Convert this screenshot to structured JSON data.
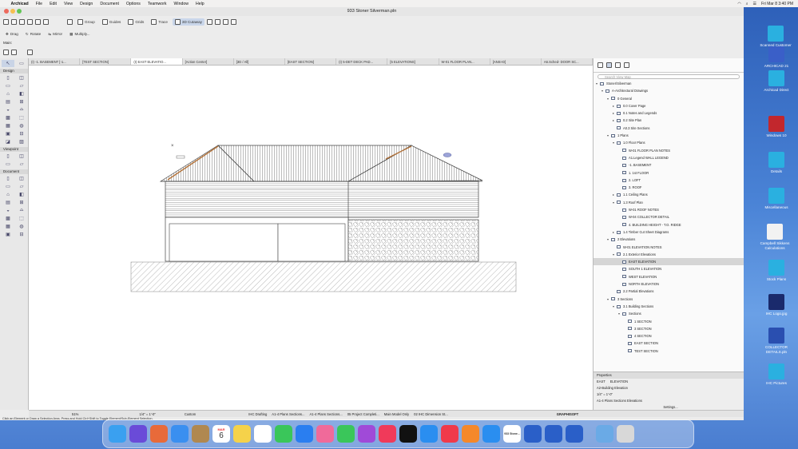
{
  "menubar": {
    "apple": "",
    "app": "Archicad",
    "items": [
      "File",
      "Edit",
      "View",
      "Design",
      "Document",
      "Options",
      "Teamwork",
      "Window",
      "Help"
    ],
    "clock": "Fri Mar 8  3:40 PM"
  },
  "window": {
    "title": "933 Stoner Silverman.pln"
  },
  "toolbar": {
    "group": "Group",
    "guides": "Guides",
    "grids": "Grids",
    "trace": "Trace",
    "cutaway": "3D Cutaway"
  },
  "toolbar2": {
    "drag": "Drag",
    "rotate": "Rotate",
    "mirror": "Mirror",
    "multiply": "Multiply...",
    "main": "Main:"
  },
  "tabs": [
    "(I) -1. BASEMENT [-1...",
    "[TEST SECTION]",
    "(I) EAST ELEVATIO...",
    "[Action Center]",
    "[3D / All]",
    "[EAST SECTION]",
    "(I) 5-DET DECK PAD...",
    "[5 ELEVATIONS]",
    "W-01 FLOOR PLAN...",
    "[ANSI-D]",
    "A6.Sched- DOOR SC..."
  ],
  "toolbox": {
    "design": "Design",
    "viewpoint": "Viewpoint",
    "document": "Document"
  },
  "navigator": {
    "search_placeholder": "Search View Map",
    "props_header": "Properties",
    "props_name_a": "EAST",
    "props_name_b": "ELEVATION",
    "props_id": "A2-Building Elevation",
    "props_scale": "1/4\"    =    1'-0\"",
    "props_layer": "A1-4 Plans Sections Elevations",
    "settings": "Settings..."
  },
  "tree": [
    {
      "d": 0,
      "t": "Stoner/Silverman",
      "a": "v"
    },
    {
      "d": 1,
      "t": "A-Architectural Drawings",
      "a": "v"
    },
    {
      "d": 2,
      "t": "0 General",
      "a": "v"
    },
    {
      "d": 3,
      "t": "0.0 Cover Page",
      "a": ">"
    },
    {
      "d": 3,
      "t": "0.1 Notes and Legends",
      "a": ">"
    },
    {
      "d": 3,
      "t": "0.2 Site Plan",
      "a": ">"
    },
    {
      "d": 3,
      "t": "A0.3 Site Sections",
      "a": ""
    },
    {
      "d": 2,
      "t": "1 Plans",
      "a": "v"
    },
    {
      "d": 3,
      "t": "1.0 Floor Plans",
      "a": "v"
    },
    {
      "d": 4,
      "t": "W-01 FLOOR PLAN NOTES",
      "a": ""
    },
    {
      "d": 4,
      "t": "A1.Legend WALL LEGEND",
      "a": ""
    },
    {
      "d": 4,
      "t": "-1. BASEMENT",
      "a": ""
    },
    {
      "d": 4,
      "t": "1. 1st FLOOR",
      "a": ""
    },
    {
      "d": 4,
      "t": "2. LOFT",
      "a": ""
    },
    {
      "d": 4,
      "t": "3. ROOF",
      "a": ""
    },
    {
      "d": 3,
      "t": "1.1 Ceiling Plans",
      "a": ">"
    },
    {
      "d": 3,
      "t": "1.3 Roof Plan",
      "a": "v"
    },
    {
      "d": 4,
      "t": "W-01 ROOF NOTES",
      "a": ""
    },
    {
      "d": 4,
      "t": "W-04 COLLECTOR DETAIL",
      "a": ""
    },
    {
      "d": 4,
      "t": "4. BUILDING HEIGHT - T.O. RIDGE",
      "a": ""
    },
    {
      "d": 3,
      "t": "1.4 Timber Cut Sheet Diagrams",
      "a": ">"
    },
    {
      "d": 2,
      "t": "2 Elevations",
      "a": "v"
    },
    {
      "d": 3,
      "t": "W-01 ELEVATION NOTES",
      "a": ""
    },
    {
      "d": 3,
      "t": "2.1 Exterior Elevations",
      "a": "v"
    },
    {
      "d": 4,
      "t": "EAST ELEVATION",
      "a": "",
      "sel": true
    },
    {
      "d": 4,
      "t": "SOUTH 1 ELEVATION",
      "a": ""
    },
    {
      "d": 4,
      "t": "WEST ELEVATION",
      "a": ""
    },
    {
      "d": 4,
      "t": "NORTH ELEVATION",
      "a": ""
    },
    {
      "d": 3,
      "t": "2.2 Partial Elevations",
      "a": ""
    },
    {
      "d": 2,
      "t": "3 Sections",
      "a": "v"
    },
    {
      "d": 3,
      "t": "3.1 Building Sections",
      "a": "v"
    },
    {
      "d": 4,
      "t": "Sections",
      "a": "v"
    },
    {
      "d": 5,
      "t": "1 SECTION",
      "a": ""
    },
    {
      "d": 5,
      "t": "3 SECTION",
      "a": ""
    },
    {
      "d": 5,
      "t": "4 SECTION",
      "a": ""
    },
    {
      "d": 5,
      "t": "EAST SECTION",
      "a": ""
    },
    {
      "d": 5,
      "t": "TEST SECTION",
      "a": ""
    }
  ],
  "status": {
    "zoom": "51%",
    "scale": "1/4\"  =  1'-0\"",
    "custom": "Custom",
    "drafting": "IHC Drafting",
    "layer": "A1-4 Plans Sections...",
    "layer2": "A1-4 Plans Sections...",
    "phase": "05 Project Completi...",
    "model": "Main Model Only",
    "dim": "02 IHC Dimension St...",
    "brand": "GRAPHISOFT"
  },
  "hint": "Click an Element or Draw a Selection Area. Press and Hold Ctrl+Shift to Toggle Element/Sub-Element Selection.",
  "desktop": [
    {
      "label": "Scanned Customer Plans",
      "color": "#2ab0e0"
    },
    {
      "label": "ARCHICAD 21",
      "color": "#3a5fc8"
    },
    {
      "label": "Archicad Direct",
      "color": "#2ab0e0"
    },
    {
      "label": "Windows 10",
      "color": "#c2272d"
    },
    {
      "label": "Details",
      "color": "#2ab0e0"
    },
    {
      "label": "Miscellaneous",
      "color": "#2ab0e0"
    },
    {
      "label": "Campbell Sikkens Calculations",
      "color": "#f2f2f2"
    },
    {
      "label": "Stock Plans",
      "color": "#2ab0e0"
    },
    {
      "label": "IHC Logo.jpg",
      "color": "#1a2a6c"
    },
    {
      "label": "COLLECTOR DETAILS.pln",
      "color": "#2a4fb0"
    },
    {
      "label": "IHC Pictures",
      "color": "#2ab0e0"
    }
  ],
  "dock": {
    "calendar_month": "MAR",
    "calendar_day": "6",
    "dock_doc_label": "933 Stone..."
  }
}
